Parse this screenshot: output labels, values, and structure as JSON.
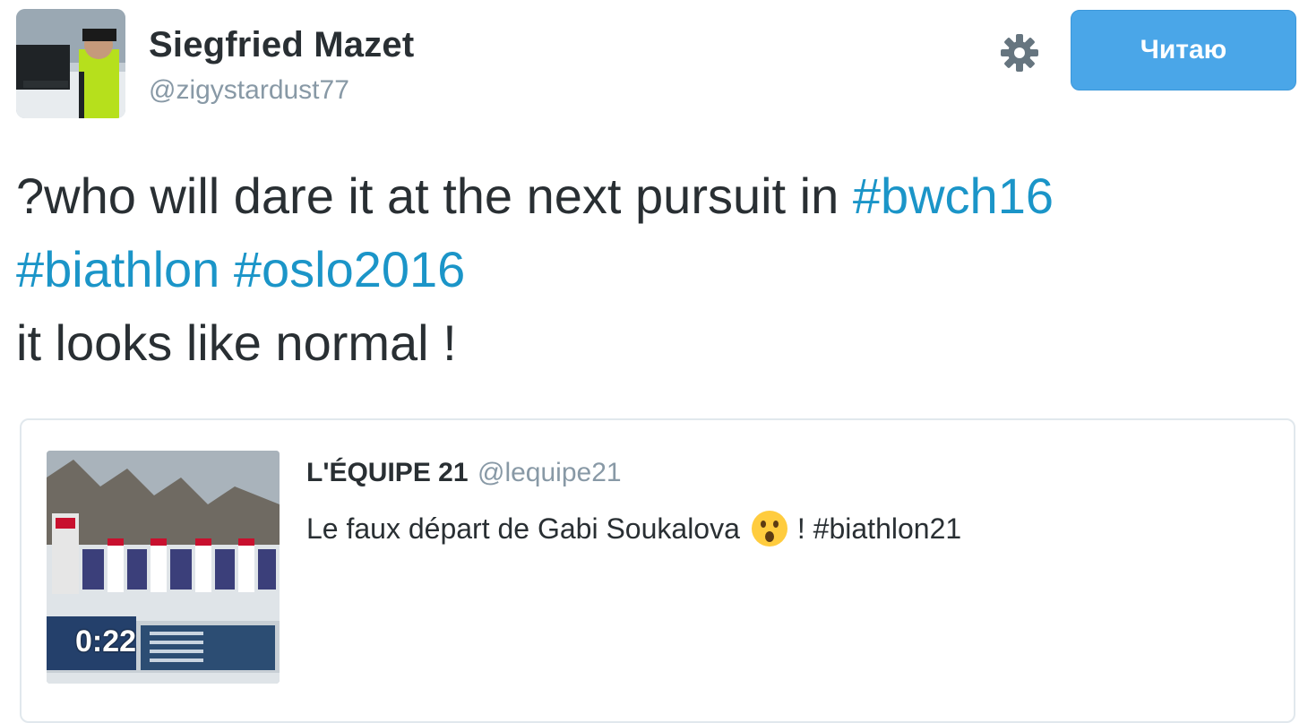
{
  "tweet": {
    "author_name": "Siegfried Mazet",
    "author_handle": "@zigystardust77",
    "follow_label": "Читаю",
    "settings_icon": "gear-icon",
    "text": {
      "line1_plain": "?who will dare it at the next pursuit in ",
      "line1_hashtag": "#bwch16",
      "line2_hashtag1": "#biathlon",
      "line2_hashtag2": "#oslo2016",
      "line3_plain": "it looks like normal !"
    },
    "colors": {
      "hashtag": "#1b95c8",
      "follow_button": "#4aa6e8",
      "muted": "#8899a6",
      "text": "#292f33"
    }
  },
  "quoted": {
    "author_name": "L'ÉQUIPE 21",
    "author_handle": "@lequipe21",
    "text_before_emoji": "Le faux départ de Gabi Soukalova",
    "emoji": "astonished-face-emoji",
    "text_after_emoji": "! #biathlon21",
    "thumbnail_timer": "0:22"
  }
}
